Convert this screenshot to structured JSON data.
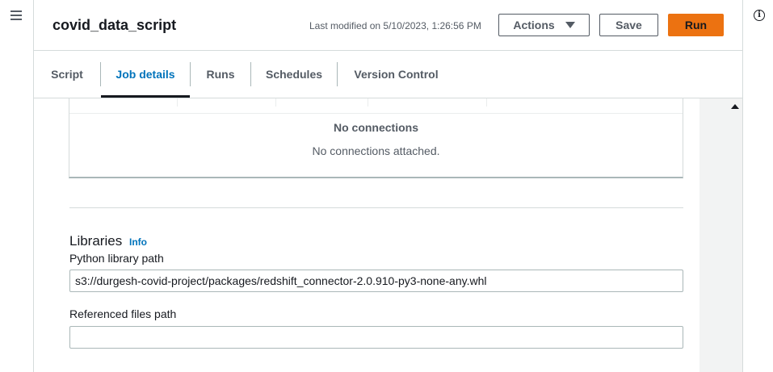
{
  "header": {
    "title": "covid_data_script",
    "last_modified": "Last modified on 5/10/2023, 1:26:56 PM",
    "actions_label": "Actions",
    "save_label": "Save",
    "run_label": "Run",
    "run_color": "#ec7211"
  },
  "tabs": [
    {
      "label": "Script",
      "active": false
    },
    {
      "label": "Job details",
      "active": true
    },
    {
      "label": "Runs",
      "active": false
    },
    {
      "label": "Schedules",
      "active": false
    },
    {
      "label": "Version Control",
      "active": false
    }
  ],
  "connections": {
    "empty_title": "No connections",
    "empty_message": "No connections attached."
  },
  "libraries": {
    "heading": "Libraries",
    "info_link": "Info",
    "python_library_path_label": "Python library path",
    "python_library_path_value": "s3://durgesh-covid-project/packages/redshift_connector-2.0.910-py3-none-any.whl",
    "referenced_files_path_label": "Referenced files path",
    "referenced_files_path_value": ""
  },
  "icons": {
    "menu": "hamburger-icon",
    "info": "info-circle-icon",
    "dropdown": "caret-down-icon",
    "scroll": "scroll-up-arrow-icon"
  },
  "colors": {
    "accent_link": "#0073bb",
    "text_secondary": "#545b64"
  }
}
